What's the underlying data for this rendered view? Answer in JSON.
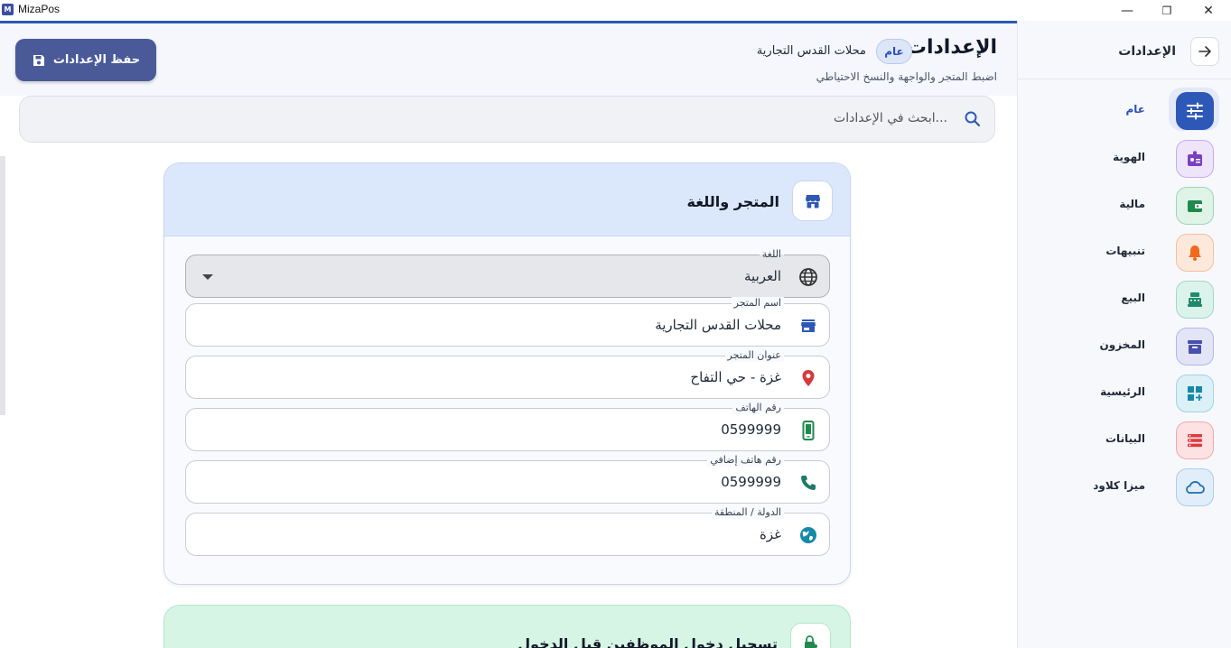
{
  "window": {
    "title": "MizaPos",
    "logo_text": "M",
    "controls": {
      "minimize": "—",
      "maximize": "❐",
      "close": "✕"
    }
  },
  "sidebar": {
    "title": "الإعدادات",
    "back_icon": "arrow-right-icon",
    "items": [
      {
        "label": "عام",
        "icon": "sliders-icon",
        "color": "#2e58b8",
        "active": true
      },
      {
        "label": "الهوية",
        "icon": "id-badge-icon",
        "color": "#7a3fc4"
      },
      {
        "label": "مالية",
        "icon": "wallet-icon",
        "color": "#1f8a4c"
      },
      {
        "label": "تنبيهات",
        "icon": "bell-icon",
        "color": "#f06a1c"
      },
      {
        "label": "البيع",
        "icon": "cash-register-icon",
        "color": "#1f8a6a"
      },
      {
        "label": "المخزون",
        "icon": "archive-icon",
        "color": "#4a4fb0"
      },
      {
        "label": "الرئيسية",
        "icon": "dashboard-icon",
        "color": "#1689a8"
      },
      {
        "label": "البيانات",
        "icon": "list-icon",
        "color": "#e0393e"
      },
      {
        "label": "ميزا كلاود",
        "icon": "cloud-icon",
        "color": "#1f6fb0"
      }
    ]
  },
  "header": {
    "title": "الإعدادات",
    "tab_pill": "عام",
    "store_name": "محلات القدس التجارية",
    "subtitle": "اضبط المتجر والواجهة والنسخ الاحتياطي",
    "save_label": "حفظ الإعدادات"
  },
  "search": {
    "placeholder": "ابحث في الإعدادات..."
  },
  "store_card": {
    "title": "المتجر واللغة",
    "fields": [
      {
        "label": "اللغة",
        "value": "العربية",
        "icon": "globe-icon",
        "type": "select"
      },
      {
        "label": "اسم المتجر",
        "value": "محلات القدس التجارية",
        "icon": "store-icon"
      },
      {
        "label": "عنوان المتجر",
        "value": "غزة - حي التفاح",
        "icon": "location-pin-icon"
      },
      {
        "label": "رقم الهاتف",
        "value": "0599999",
        "icon": "smartphone-icon"
      },
      {
        "label": "رقم هاتف إضافي",
        "value": "0599999",
        "icon": "phone-icon"
      },
      {
        "label": "الدولة / المنطقة",
        "value": "غزة",
        "icon": "earth-icon"
      }
    ]
  },
  "login_card": {
    "title": "تسجيل دخول الموظفين قبل الدخول"
  },
  "colors": {
    "accent": "#2e58b8",
    "save_button": "#4a5a99",
    "card_header": "#dbe7fb",
    "login_card": "#d6f5e4"
  }
}
